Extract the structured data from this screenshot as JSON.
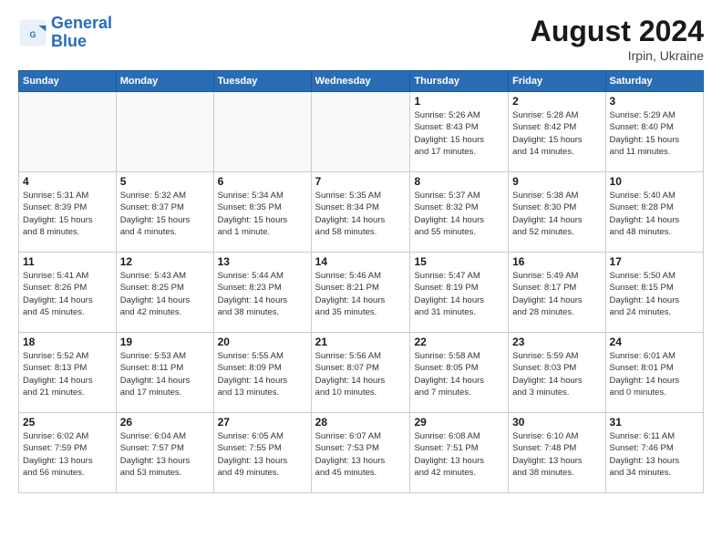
{
  "header": {
    "logo_line1": "General",
    "logo_line2": "Blue",
    "month_title": "August 2024",
    "subtitle": "Irpin, Ukraine"
  },
  "days_of_week": [
    "Sunday",
    "Monday",
    "Tuesday",
    "Wednesday",
    "Thursday",
    "Friday",
    "Saturday"
  ],
  "weeks": [
    [
      {
        "day": "",
        "info": ""
      },
      {
        "day": "",
        "info": ""
      },
      {
        "day": "",
        "info": ""
      },
      {
        "day": "",
        "info": ""
      },
      {
        "day": "1",
        "info": "Sunrise: 5:26 AM\nSunset: 8:43 PM\nDaylight: 15 hours\nand 17 minutes."
      },
      {
        "day": "2",
        "info": "Sunrise: 5:28 AM\nSunset: 8:42 PM\nDaylight: 15 hours\nand 14 minutes."
      },
      {
        "day": "3",
        "info": "Sunrise: 5:29 AM\nSunset: 8:40 PM\nDaylight: 15 hours\nand 11 minutes."
      }
    ],
    [
      {
        "day": "4",
        "info": "Sunrise: 5:31 AM\nSunset: 8:39 PM\nDaylight: 15 hours\nand 8 minutes."
      },
      {
        "day": "5",
        "info": "Sunrise: 5:32 AM\nSunset: 8:37 PM\nDaylight: 15 hours\nand 4 minutes."
      },
      {
        "day": "6",
        "info": "Sunrise: 5:34 AM\nSunset: 8:35 PM\nDaylight: 15 hours\nand 1 minute."
      },
      {
        "day": "7",
        "info": "Sunrise: 5:35 AM\nSunset: 8:34 PM\nDaylight: 14 hours\nand 58 minutes."
      },
      {
        "day": "8",
        "info": "Sunrise: 5:37 AM\nSunset: 8:32 PM\nDaylight: 14 hours\nand 55 minutes."
      },
      {
        "day": "9",
        "info": "Sunrise: 5:38 AM\nSunset: 8:30 PM\nDaylight: 14 hours\nand 52 minutes."
      },
      {
        "day": "10",
        "info": "Sunrise: 5:40 AM\nSunset: 8:28 PM\nDaylight: 14 hours\nand 48 minutes."
      }
    ],
    [
      {
        "day": "11",
        "info": "Sunrise: 5:41 AM\nSunset: 8:26 PM\nDaylight: 14 hours\nand 45 minutes."
      },
      {
        "day": "12",
        "info": "Sunrise: 5:43 AM\nSunset: 8:25 PM\nDaylight: 14 hours\nand 42 minutes."
      },
      {
        "day": "13",
        "info": "Sunrise: 5:44 AM\nSunset: 8:23 PM\nDaylight: 14 hours\nand 38 minutes."
      },
      {
        "day": "14",
        "info": "Sunrise: 5:46 AM\nSunset: 8:21 PM\nDaylight: 14 hours\nand 35 minutes."
      },
      {
        "day": "15",
        "info": "Sunrise: 5:47 AM\nSunset: 8:19 PM\nDaylight: 14 hours\nand 31 minutes."
      },
      {
        "day": "16",
        "info": "Sunrise: 5:49 AM\nSunset: 8:17 PM\nDaylight: 14 hours\nand 28 minutes."
      },
      {
        "day": "17",
        "info": "Sunrise: 5:50 AM\nSunset: 8:15 PM\nDaylight: 14 hours\nand 24 minutes."
      }
    ],
    [
      {
        "day": "18",
        "info": "Sunrise: 5:52 AM\nSunset: 8:13 PM\nDaylight: 14 hours\nand 21 minutes."
      },
      {
        "day": "19",
        "info": "Sunrise: 5:53 AM\nSunset: 8:11 PM\nDaylight: 14 hours\nand 17 minutes."
      },
      {
        "day": "20",
        "info": "Sunrise: 5:55 AM\nSunset: 8:09 PM\nDaylight: 14 hours\nand 13 minutes."
      },
      {
        "day": "21",
        "info": "Sunrise: 5:56 AM\nSunset: 8:07 PM\nDaylight: 14 hours\nand 10 minutes."
      },
      {
        "day": "22",
        "info": "Sunrise: 5:58 AM\nSunset: 8:05 PM\nDaylight: 14 hours\nand 7 minutes."
      },
      {
        "day": "23",
        "info": "Sunrise: 5:59 AM\nSunset: 8:03 PM\nDaylight: 14 hours\nand 3 minutes."
      },
      {
        "day": "24",
        "info": "Sunrise: 6:01 AM\nSunset: 8:01 PM\nDaylight: 14 hours\nand 0 minutes."
      }
    ],
    [
      {
        "day": "25",
        "info": "Sunrise: 6:02 AM\nSunset: 7:59 PM\nDaylight: 13 hours\nand 56 minutes."
      },
      {
        "day": "26",
        "info": "Sunrise: 6:04 AM\nSunset: 7:57 PM\nDaylight: 13 hours\nand 53 minutes."
      },
      {
        "day": "27",
        "info": "Sunrise: 6:05 AM\nSunset: 7:55 PM\nDaylight: 13 hours\nand 49 minutes."
      },
      {
        "day": "28",
        "info": "Sunrise: 6:07 AM\nSunset: 7:53 PM\nDaylight: 13 hours\nand 45 minutes."
      },
      {
        "day": "29",
        "info": "Sunrise: 6:08 AM\nSunset: 7:51 PM\nDaylight: 13 hours\nand 42 minutes."
      },
      {
        "day": "30",
        "info": "Sunrise: 6:10 AM\nSunset: 7:48 PM\nDaylight: 13 hours\nand 38 minutes."
      },
      {
        "day": "31",
        "info": "Sunrise: 6:11 AM\nSunset: 7:46 PM\nDaylight: 13 hours\nand 34 minutes."
      }
    ]
  ]
}
